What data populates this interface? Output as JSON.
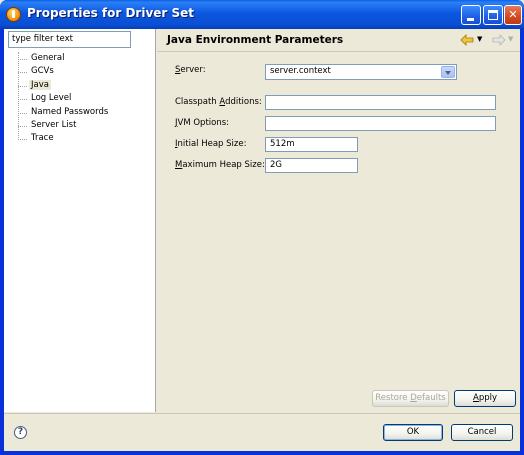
{
  "window": {
    "title": "Properties for Driver Set"
  },
  "filter": {
    "placeholder": "type filter text",
    "value": "type filter text"
  },
  "tree": {
    "items": [
      {
        "label": "General"
      },
      {
        "label": "GCVs"
      },
      {
        "label": "Java"
      },
      {
        "label": "Log Level"
      },
      {
        "label": "Named Passwords"
      },
      {
        "label": "Server List"
      },
      {
        "label": "Trace"
      }
    ]
  },
  "page": {
    "title": "Java Environment Parameters",
    "server": {
      "label_ul": "S",
      "label_rest": "erver:",
      "value": "server.context"
    },
    "classpath": {
      "label_pre": "Classpath ",
      "label_ul": "A",
      "label_rest": "dditions:",
      "value": ""
    },
    "jvm": {
      "label_ul": "J",
      "label_rest": "VM Options:",
      "value": ""
    },
    "initial_heap": {
      "label_ul": "I",
      "label_rest": "nitial Heap Size:",
      "value": "512m"
    },
    "max_heap": {
      "label_ul": "M",
      "label_rest": "aximum Heap Size:",
      "value": "2G"
    },
    "restore_defaults": {
      "label_pre": "Restore ",
      "label_ul": "D",
      "label_rest": "efaults"
    },
    "apply": {
      "label_pre": "",
      "label_ul": "A",
      "label_rest": "pply"
    }
  },
  "dialog": {
    "ok_label": "OK",
    "cancel_label": "Cancel",
    "help_glyph": "?"
  },
  "icons": {
    "title_icon": "eclipse-properties-icon",
    "back": "back-arrow-icon",
    "forward": "forward-arrow-icon",
    "help": "help-icon"
  }
}
